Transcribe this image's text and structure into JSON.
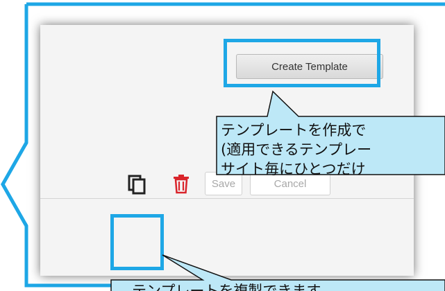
{
  "panel": {
    "create_template_label": "Create Template",
    "save_label": "Save",
    "cancel_label": "Cancel"
  },
  "callout_top": {
    "lines": [
      "テンプレートを作成で",
      "(適用できるテンプレー",
      "サイト毎にひとつだけ"
    ]
  },
  "callout_bottom": {
    "text": "テンプレートを複製できます"
  },
  "icons": {
    "copy": "copy-icon",
    "trash": "trash-icon"
  },
  "colors": {
    "highlight": "#1ea7e6",
    "callout_fill": "#bde8f7",
    "trash": "#d9242b"
  }
}
